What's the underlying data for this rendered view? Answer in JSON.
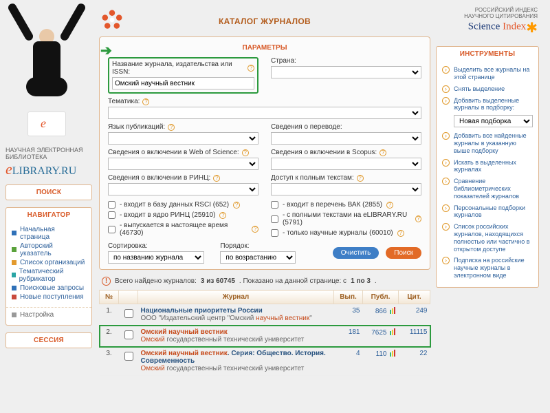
{
  "header": {
    "page_title": "КАТАЛОГ ЖУРНАЛОВ"
  },
  "left": {
    "logo_small": "НАУЧНАЯ ЭЛЕКТРОННАЯ\nБИБЛИОТЕКА",
    "logo_main_e": "e",
    "logo_main_rest": "LIBRARY.RU",
    "search_title": "ПОИСК",
    "nav_title": "НАВИГАТОР",
    "nav_items": [
      "Начальная страница",
      "Авторский указатель",
      "Список организаций",
      "Тематический рубрикатор",
      "Поисковые запросы",
      "Новые поступления"
    ],
    "settings_label": "Настройка",
    "session_title": "СЕССИЯ"
  },
  "params": {
    "title": "ПАРАМЕТРЫ",
    "labels": {
      "name": "Название журнала, издательства или ISSN:",
      "country": "Страна:",
      "subject": "Тематика:",
      "lang": "Язык публикаций:",
      "translate": "Сведения о переводе:",
      "wos": "Сведения о включении в Web of Science:",
      "scopus": "Сведения о включении в Scopus:",
      "rinc": "Сведения о включении в РИНЦ:",
      "fulltext": "Доступ к полным текстам:",
      "sort": "Сортировка:",
      "order": "Порядок:"
    },
    "name_value": "Омский научный вестник",
    "checks": [
      "- входит в базу данных RSCI (652)",
      "- входит в ядро РИНЦ (25910)",
      "- выпускается в настоящее время (46730)",
      "- входит в перечень ВАК (2855)",
      "- с полными текстами на eLIBRARY.RU (5791)",
      "- только научные журналы (60010)"
    ],
    "sort_value": "по названию журнала",
    "order_value": "по возрастанию",
    "btn_clear": "Очистить",
    "btn_search": "Поиск"
  },
  "results": {
    "note_prefix": "Всего найдено журналов:",
    "found_bold": "3 из 60745",
    "note_sep": ".   Показано на данной странице: с",
    "range": "1 по 3",
    "cols": {
      "no": "№",
      "journal": "Журнал",
      "issues": "Вып.",
      "pubs": "Публ.",
      "cit": "Цит."
    },
    "rows": [
      {
        "n": "1.",
        "title": "Национальные приоритеты России",
        "sub_pre": "ООО \"Издательский центр \"Омский ",
        "sub_hl": "научный вестник",
        "sub_post": "\"",
        "issues": "35",
        "pubs": "866",
        "cit": "249"
      },
      {
        "n": "2.",
        "title_hl": "Омский научный вестник",
        "sub_hl": "Омский",
        "sub_post": " государственный технический университет",
        "issues": "181",
        "pubs": "7625",
        "cit": "11115",
        "highlight": true
      },
      {
        "n": "3.",
        "title_hl": "Омский научный вестник",
        "title_post": ". Серия: Общество. История. Современность",
        "sub_hl": "Омский",
        "sub_post": " государственный технический университет",
        "issues": "4",
        "pubs": "110",
        "cit": "22"
      }
    ]
  },
  "right": {
    "index_small": "РОССИЙСКИЙ ИНДЕКС\nНАУЧНОГО ЦИТИРОВАНИЯ",
    "index_big_s": "Science ",
    "index_big_i": "Index",
    "tools_title": "ИНСТРУМЕНТЫ",
    "tools": [
      "Выделить все журналы на этой странице",
      "Снять выделение",
      "Добавить выделенные журналы в подборку:",
      "Добавить все найденные журналы в указанную выше подборку",
      "Искать в выделенных журналах",
      "Сравнение библиометрических показателей журналов",
      "Персональные подборки журналов",
      "Список российских журналов, находящихся полностью или частично в открытом доступе",
      "Подписка на российские научные журналы в электронном виде"
    ],
    "picker": "Новая подборка"
  }
}
